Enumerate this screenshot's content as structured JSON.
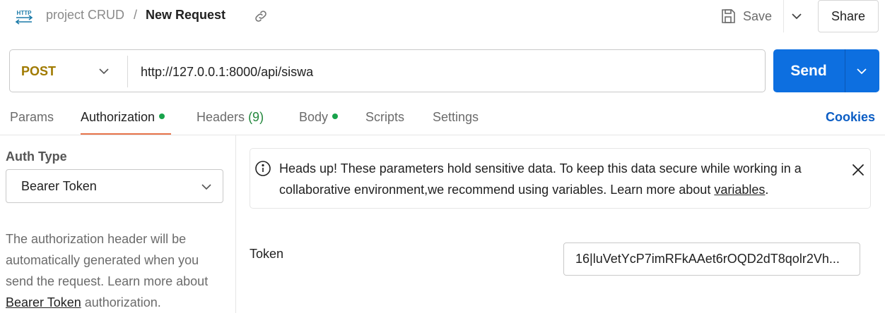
{
  "header": {
    "icon_text": "HTTP",
    "breadcrumb": {
      "collection": "project CRUD",
      "separator": "/",
      "title": "New Request"
    },
    "save_label": "Save",
    "share_label": "Share"
  },
  "request": {
    "method": "POST",
    "url": "http://127.0.0.1:8000/api/siswa",
    "send_label": "Send"
  },
  "tabs": [
    {
      "label": "Params"
    },
    {
      "label": "Authorization",
      "dot": true,
      "active": true
    },
    {
      "label": "Headers",
      "count": "(9)"
    },
    {
      "label": "Body",
      "dot": true
    },
    {
      "label": "Scripts"
    },
    {
      "label": "Settings"
    }
  ],
  "cookies_label": "Cookies",
  "auth": {
    "type_label": "Auth Type",
    "type_value": "Bearer Token",
    "help_prefix": "The authorization header will be automatically generated when you send the request. Learn more about ",
    "help_link": "Bearer Token",
    "help_suffix": " authorization."
  },
  "notice": {
    "text_prefix": "Heads up! These parameters hold sensitive data. To keep this data secure while working in a collaborative environment,we recommend using variables. Learn more about ",
    "link": "variables",
    "text_suffix": "."
  },
  "token": {
    "label": "Token",
    "value": "16|luVetYcP7imRFkAAet6rOQD2dT8qolr2Vh..."
  },
  "colors": {
    "send": "#0d6fe0",
    "method": "#a07a00",
    "tab_accent": "#e8744a",
    "dot": "#18a34b",
    "link": "#0b5dc4"
  }
}
